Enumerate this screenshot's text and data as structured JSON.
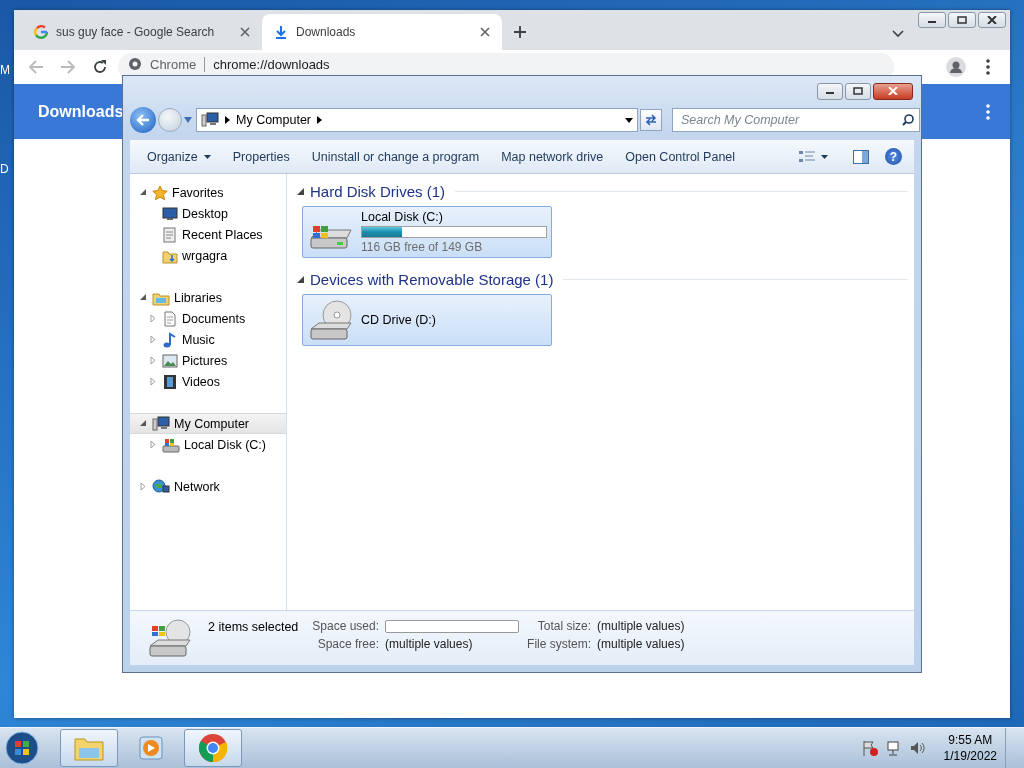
{
  "desktop_labels": [
    "M",
    "D"
  ],
  "chrome": {
    "tabs": [
      {
        "kind": "site",
        "title": "sus guy face - Google Search",
        "selected": false
      },
      {
        "kind": "download",
        "title": "Downloads",
        "selected": true
      }
    ],
    "omnibox": {
      "chip": "Chrome",
      "url": "chrome://downloads"
    },
    "page_title": "Downloads"
  },
  "explorer": {
    "address": {
      "crumb": "My Computer"
    },
    "search": {
      "placeholder": "Search My Computer"
    },
    "commands": [
      {
        "label": "Organize",
        "dropdown": true
      },
      {
        "label": "Properties",
        "dropdown": false
      },
      {
        "label": "Uninstall or change a program",
        "dropdown": false
      },
      {
        "label": "Map network drive",
        "dropdown": false
      },
      {
        "label": "Open Control Panel",
        "dropdown": false
      }
    ],
    "help_label": "?",
    "nav": [
      {
        "kind": "favorites",
        "label": "Favorites",
        "expanded": true,
        "selected": false,
        "children": [
          {
            "kind": "desktop",
            "label": "Desktop"
          },
          {
            "kind": "recent",
            "label": "Recent Places"
          },
          {
            "kind": "folder",
            "label": "wrgagra"
          }
        ]
      },
      {
        "kind": "library",
        "label": "Libraries",
        "expanded": true,
        "selected": false,
        "children": [
          {
            "kind": "documents",
            "label": "Documents",
            "expanded": false
          },
          {
            "kind": "music",
            "label": "Music",
            "expanded": false
          },
          {
            "kind": "pictures",
            "label": "Pictures",
            "expanded": false
          },
          {
            "kind": "videos",
            "label": "Videos",
            "expanded": false
          }
        ]
      },
      {
        "kind": "computer",
        "label": "My Computer",
        "expanded": true,
        "selected": true,
        "children": [
          {
            "kind": "drive",
            "label": "Local Disk (C:)",
            "expanded": false
          }
        ]
      },
      {
        "kind": "network",
        "label": "Network",
        "expanded": false,
        "selected": false
      }
    ],
    "groups": [
      {
        "title": "Hard Disk Drives (1)",
        "expanded": true,
        "items": [
          {
            "kind": "hard-disk",
            "name": "Local Disk (C:)",
            "level": 0.22,
            "free": "116 GB free of 149 GB",
            "selected": true
          }
        ]
      },
      {
        "title": "Devices with Removable Storage (1)",
        "expanded": true,
        "items": [
          {
            "kind": "cd-drive",
            "name": "CD Drive (D:)",
            "selected": true
          }
        ]
      }
    ],
    "status": {
      "summary": "2 items selected",
      "fields": [
        {
          "kind": "bar",
          "label": "Space used:",
          "level": 0
        },
        {
          "kind": "text",
          "label": "Total size:",
          "value": "(multiple values)"
        },
        {
          "kind": "text",
          "label": "Space free:",
          "value": "(multiple values)"
        },
        {
          "kind": "text",
          "label": "File system:",
          "value": "(multiple values)"
        }
      ]
    }
  },
  "taskbar": {
    "apps": [
      {
        "kind": "explorer",
        "active": true
      },
      {
        "kind": "media",
        "active": false
      },
      {
        "kind": "chrome",
        "active": true
      }
    ],
    "time": "9:55 AM",
    "date": "1/19/2022"
  }
}
